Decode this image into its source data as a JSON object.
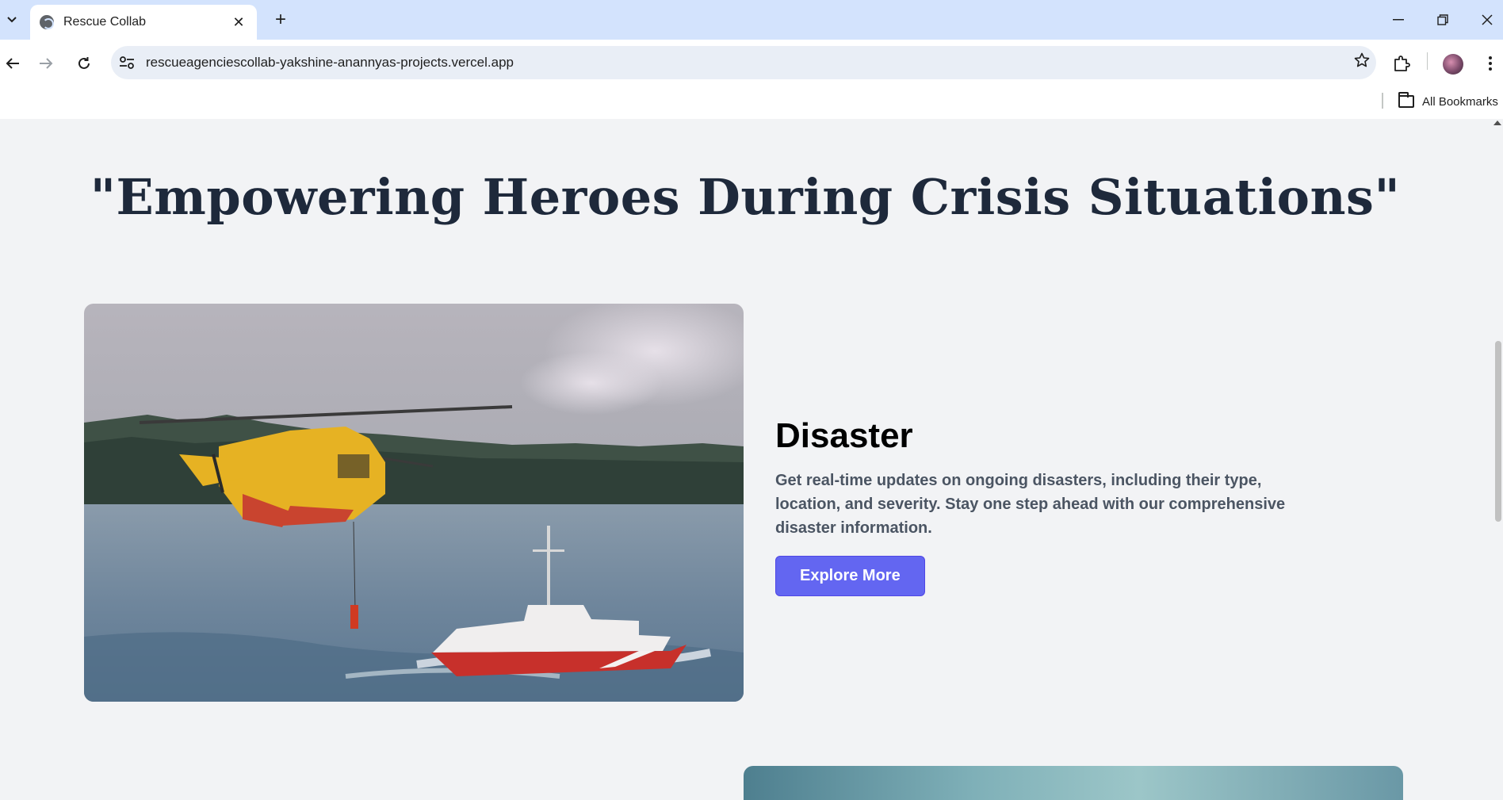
{
  "browser": {
    "tab_title": "Rescue Collab",
    "url": "rescueagenciescollab-yakshine-anannyas-projects.vercel.app",
    "bookmarks_label": "All Bookmarks",
    "icons": {
      "tab_list": "chevron-down-icon",
      "favicon": "globe-icon",
      "close_tab": "close-icon",
      "new_tab": "plus-icon",
      "minimize": "minimize-icon",
      "restore": "restore-icon",
      "close_window": "close-icon",
      "back": "arrow-left-icon",
      "forward": "arrow-right-icon",
      "reload": "reload-icon",
      "site_info": "tune-icon",
      "bookmark_star": "star-icon",
      "extensions": "puzzle-icon",
      "profile": "avatar",
      "menu": "kebab-menu-icon",
      "bookmarks_folder": "folder-icon"
    }
  },
  "page": {
    "hero_title": "\"Empowering Heroes During Crisis Situations\"",
    "sections": [
      {
        "heading": "Disaster",
        "description": "Get real-time updates on ongoing disasters, including their type, location, and severity. Stay one step ahead with our comprehensive disaster information.",
        "button_label": "Explore More",
        "image_alt": "Rescue helicopter and coast guard boat at sea"
      }
    ]
  },
  "colors": {
    "accent": "#6366f1",
    "page_bg": "#f2f3f5",
    "title_text": "#1e293b",
    "body_text": "#4b5563",
    "chrome_bg": "#d3e3fd"
  }
}
